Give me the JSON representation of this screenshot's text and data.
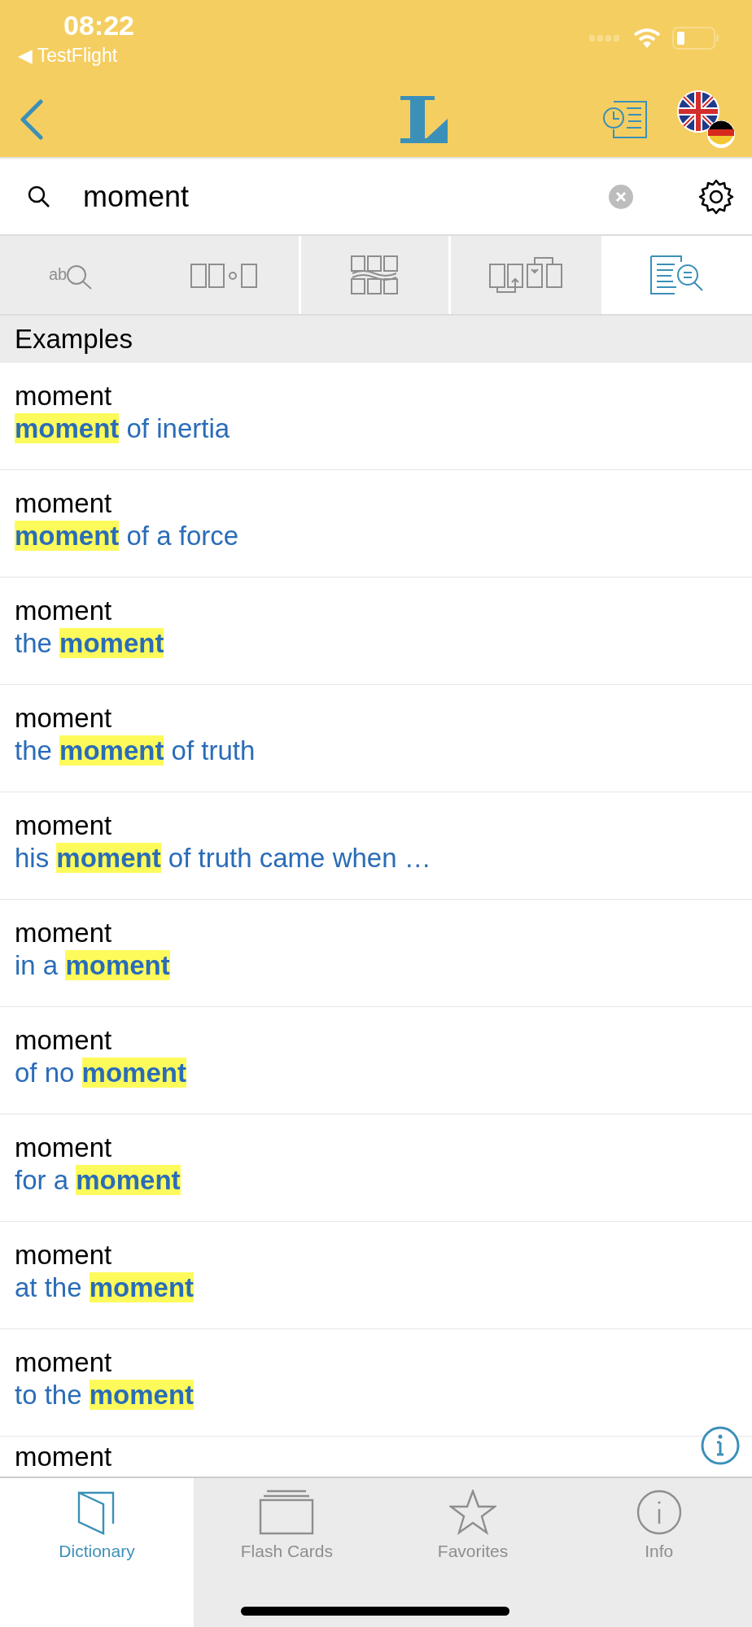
{
  "status_bar": {
    "time": "08:22",
    "back_app": "◀ TestFlight"
  },
  "search": {
    "value": "moment"
  },
  "mode_tabs": [
    {
      "kind": "spelling",
      "selected": false,
      "divider": false,
      "icon_text": "ab"
    },
    {
      "kind": "missing",
      "selected": false,
      "divider": true
    },
    {
      "kind": "fuzzy",
      "selected": false,
      "divider": true
    },
    {
      "kind": "compounds",
      "selected": false,
      "divider": false
    },
    {
      "kind": "examples",
      "selected": true,
      "divider": false
    }
  ],
  "section": {
    "title": "Examples"
  },
  "results": [
    {
      "headword": "moment",
      "match": "moment",
      "after": " of inertia"
    },
    {
      "headword": "moment",
      "match": "moment",
      "after": " of a force"
    },
    {
      "headword": "moment",
      "before": "the ",
      "match": "moment"
    },
    {
      "headword": "moment",
      "before": "the ",
      "match": "moment",
      "after": " of truth"
    },
    {
      "headword": "moment",
      "before": "his ",
      "match": "moment",
      "after": " of truth came when …"
    },
    {
      "headword": "moment",
      "before": "in a ",
      "match": "moment"
    },
    {
      "headword": "moment",
      "before": "of no ",
      "match": "moment"
    },
    {
      "headword": "moment",
      "before": "for a ",
      "match": "moment"
    },
    {
      "headword": "moment",
      "before": "at the ",
      "match": "moment"
    },
    {
      "headword": "moment",
      "before": "to the ",
      "match": "moment"
    },
    {
      "headword": "moment"
    }
  ],
  "tab_bar": [
    {
      "kind": "book",
      "label": "Dictionary",
      "selected": true
    },
    {
      "kind": "cards",
      "label": "Flash Cards",
      "selected": false
    },
    {
      "kind": "star",
      "label": "Favorites",
      "selected": false
    },
    {
      "kind": "info",
      "label": "Info",
      "selected": false
    }
  ]
}
